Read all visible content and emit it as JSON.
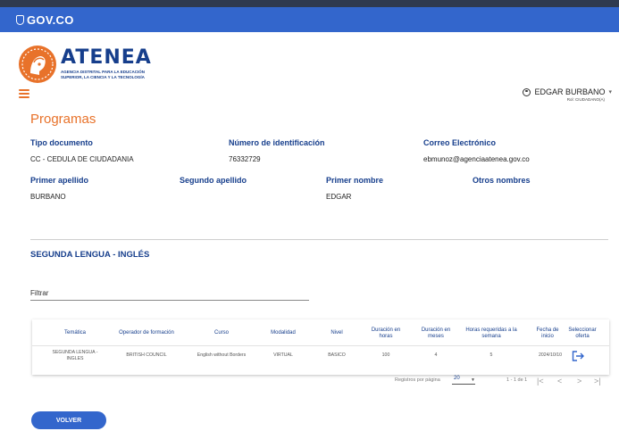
{
  "gov_bar": {
    "logo_text": "GOV.CO"
  },
  "brand": {
    "title": "ATENEA",
    "subtitle": "AGENCIA DISTRITAL PARA LA EDUCACIÓN SUPERIOR, LA CIENCIA Y LA TECNOLOGÍA"
  },
  "user": {
    "name": "EDGAR BURBANO",
    "role": "Rol: CIUDADANO(A)"
  },
  "page_title": "Programas",
  "profile": {
    "tipo_documento": {
      "label": "Tipo documento",
      "value": "CC - CEDULA DE CIUDADANIA"
    },
    "numero_identificacion": {
      "label": "Número de identificación",
      "value": "76332729"
    },
    "correo": {
      "label": "Correo Electrónico",
      "value": "ebmunoz@agenciaatenea.gov.co"
    },
    "primer_apellido": {
      "label": "Primer apellido",
      "value": "BURBANO"
    },
    "segundo_apellido": {
      "label": "Segundo apellido",
      "value": ""
    },
    "primer_nombre": {
      "label": "Primer nombre",
      "value": "EDGAR"
    },
    "otros_nombres": {
      "label": "Otros nombres",
      "value": ""
    }
  },
  "section_title": "SEGUNDA LENGUA - INGLÉS",
  "filter": {
    "label": "Filtrar"
  },
  "table": {
    "columns": [
      "Temática",
      "Operador de formación",
      "Curso",
      "Modalidad",
      "Nivel",
      "Duración en horas",
      "Duración en meses",
      "Horas requeridas a la semana",
      "Fecha de inicio",
      "Seleccionar oferta"
    ],
    "rows": [
      [
        "SEGUNDA LENGUA - INGLES",
        "BRITISH COUNCIL",
        "English without Borders",
        "VIRTUAL",
        "BASICO",
        "100",
        "4",
        "5",
        "2024/10/10"
      ]
    ]
  },
  "pager": {
    "label": "Registros por página",
    "size": "20",
    "range": "1 - 1 de 1"
  },
  "actions": {
    "back": "VOLVER"
  },
  "colors": {
    "gov_blue": "#3366cc",
    "brand_navy": "#163e8c",
    "accent_orange": "#e8722a"
  }
}
